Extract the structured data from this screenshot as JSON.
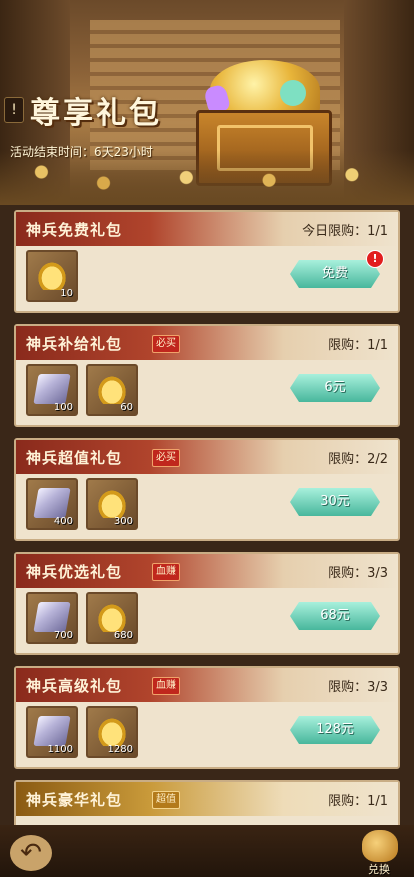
{
  "header": {
    "title": "尊享礼包",
    "timer": "活动结束时间：6天23小时",
    "info_icon": "!"
  },
  "packs": [
    {
      "name": "神兵免费礼包",
      "tag": "",
      "limit": "今日限购：1/1",
      "items": [
        {
          "icon": "gold-ingot",
          "qty": "10"
        }
      ],
      "price": "免费",
      "red_dot": "!"
    },
    {
      "name": "神兵补给礼包",
      "tag": "必买",
      "limit": "限购：1/1",
      "items": [
        {
          "icon": "silver-stone",
          "qty": "100"
        },
        {
          "icon": "gold-ingot",
          "qty": "60"
        }
      ],
      "price": "6元"
    },
    {
      "name": "神兵超值礼包",
      "tag": "必买",
      "limit": "限购：2/2",
      "items": [
        {
          "icon": "silver-stone",
          "qty": "400"
        },
        {
          "icon": "gold-ingot",
          "qty": "300"
        }
      ],
      "price": "30元"
    },
    {
      "name": "神兵优选礼包",
      "tag": "血赚",
      "limit": "限购：3/3",
      "items": [
        {
          "icon": "silver-stone",
          "qty": "700"
        },
        {
          "icon": "gold-ingot",
          "qty": "680"
        }
      ],
      "price": "68元"
    },
    {
      "name": "神兵高级礼包",
      "tag": "血赚",
      "limit": "限购：3/3",
      "items": [
        {
          "icon": "silver-stone",
          "qty": "1100"
        },
        {
          "icon": "gold-ingot",
          "qty": "1280"
        }
      ],
      "price": "128元"
    },
    {
      "name": "神兵豪华礼包",
      "tag": "超值",
      "limit": "限购：1/1",
      "items": [],
      "price": ""
    }
  ],
  "footer": {
    "back_icon": "↶",
    "exchange_label": "兑换"
  },
  "colors": {
    "button": "#48b79c",
    "header_red": "#8a2a1c",
    "header_gold": "#8a5a12",
    "tag_red": "#c0271d",
    "tag_gold": "#b37a1a"
  }
}
